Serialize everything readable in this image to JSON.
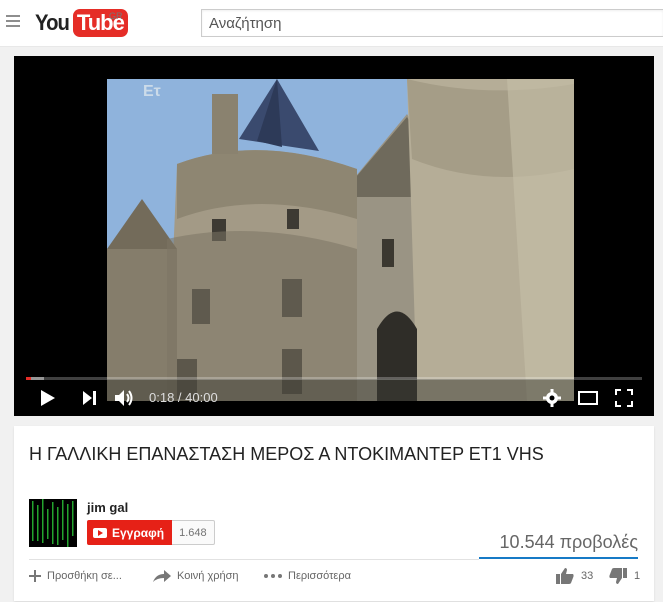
{
  "header": {
    "logo_you": "You",
    "logo_tube": "Tube",
    "country": "GR",
    "search_placeholder": "Αναζήτηση"
  },
  "player": {
    "channel_mark": "Eτ",
    "time_current": "0:18",
    "time_separator": " / ",
    "time_total": "40:00",
    "progress_played_fraction": 0.0075,
    "progress_loaded_fraction": 0.03
  },
  "video": {
    "title": "Η ΓΑΛΛΙΚΗ ΕΠΑΝΑΣΤΑΣΗ ΜΕΡΟΣ Α ΝΤΟΚΙΜΑΝΤΕΡ ΕΤ1 VHS",
    "channel_name": "jim gal",
    "subscribe_label": "Εγγραφή",
    "subscriber_count": "1.648",
    "views": "10.544 προβολές"
  },
  "actions": {
    "add_to": "Προσθήκη σε...",
    "share": "Κοινή χρήση",
    "more": "Περισσότερα",
    "likes": "33",
    "dislikes": "1"
  },
  "colors": {
    "brand_red": "#e52d27",
    "subscribe_red": "#e62117",
    "views_bar": "#167ac6"
  }
}
